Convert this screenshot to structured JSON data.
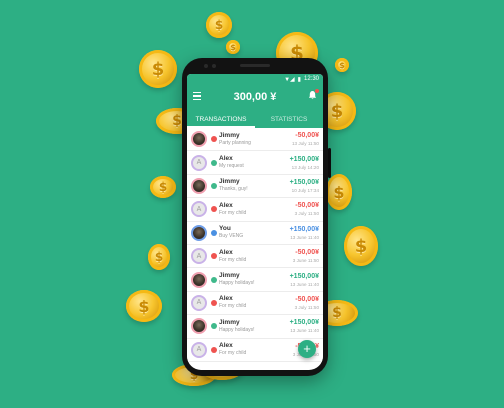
{
  "statusbar": {
    "time": "12:30",
    "signal": "▼◢",
    "battery": "▮"
  },
  "appbar": {
    "balance": "300,00 ¥",
    "menu_icon": "menu-icon",
    "bell_icon": "bell-icon"
  },
  "tabs": [
    {
      "label": "TRANSACTIONS",
      "active": true
    },
    {
      "label": "STATISTICS",
      "active": false
    }
  ],
  "transactions": [
    {
      "name": "Jimmy",
      "note": "Party planning",
      "amount": "-50,00¥",
      "date": "13 July 11:50",
      "type": "out",
      "avatar": "photo"
    },
    {
      "name": "Alex",
      "note": "My request",
      "amount": "+150,00¥",
      "date": "13 July 14:20",
      "type": "in",
      "avatar": "A"
    },
    {
      "name": "Jimmy",
      "note": "Thanks, guy!",
      "amount": "+150,00¥",
      "date": "10 July 17:34",
      "type": "in",
      "avatar": "photo"
    },
    {
      "name": "Alex",
      "note": "For my child",
      "amount": "-50,00¥",
      "date": "3 July 11:50",
      "type": "out",
      "avatar": "A"
    },
    {
      "name": "You",
      "note": "Buy VENG",
      "amount": "+150,00¥",
      "date": "13 June 11:40",
      "type": "self",
      "avatar": "photo"
    },
    {
      "name": "Alex",
      "note": "For my child",
      "amount": "-50,00¥",
      "date": "3 June 11:50",
      "type": "out",
      "avatar": "A"
    },
    {
      "name": "Jimmy",
      "note": "Happy holidays!",
      "amount": "+150,00¥",
      "date": "13 June 11:40",
      "type": "in",
      "avatar": "photo"
    },
    {
      "name": "Alex",
      "note": "For my child",
      "amount": "-50,00¥",
      "date": "3 July 11:50",
      "type": "out",
      "avatar": "A"
    },
    {
      "name": "Jimmy",
      "note": "Happy holidays!",
      "amount": "+150,00¥",
      "date": "13 June 11:40",
      "type": "in",
      "avatar": "photo"
    },
    {
      "name": "Alex",
      "note": "For my child",
      "amount": "-50,00¥",
      "date": "3 June 11:50",
      "type": "out",
      "avatar": "A"
    }
  ],
  "fab": {
    "label": "+"
  },
  "coin_symbol": "$",
  "colors": {
    "brand": "#2daf84",
    "negative": "#ef5350",
    "positive": "#2daf84",
    "self": "#4a90e2",
    "coin": "#f7c52e"
  }
}
